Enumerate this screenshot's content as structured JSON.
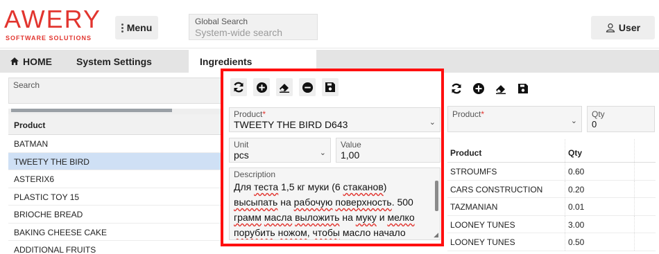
{
  "logo": {
    "main": "AWERY",
    "sub": "SOFTWARE SOLUTIONS"
  },
  "header": {
    "menu_label": "Menu",
    "search_label": "Global Search",
    "search_placeholder": "System-wide search",
    "user_label": "User"
  },
  "nav": {
    "home": "HOME",
    "settings": "System Settings",
    "ingredients": "Ingredients"
  },
  "left": {
    "search_label": "Search",
    "column_header": "Product",
    "items": [
      "BATMAN",
      "TWEETY THE BIRD",
      "ASTERIX6",
      "PLASTIC TOY 15",
      "BRIOCHE BREAD",
      "BAKING CHEESE CAKE",
      "ADDITIONAL FRUITS"
    ],
    "selected_index": 1
  },
  "form": {
    "product_label": "Product",
    "required_mark": "*",
    "product_value": "TWEETY THE BIRD D643",
    "unit_label": "Unit",
    "unit_value": "pcs",
    "value_label": "Value",
    "value_value": "1,00",
    "description_label": "Description",
    "description_segments": [
      {
        "t": "Для ",
        "u": false
      },
      {
        "t": "теста",
        "u": true
      },
      {
        "t": " 1,5 кг муки (6 ",
        "u": false
      },
      {
        "t": "стаканов",
        "u": true
      },
      {
        "t": ") ",
        "u": false
      },
      {
        "t": "высыпать",
        "u": true
      },
      {
        "t": " на ",
        "u": false
      },
      {
        "t": "рабочую",
        "u": true
      },
      {
        "t": " ",
        "u": false
      },
      {
        "t": "поверхность",
        "u": true
      },
      {
        "t": ". 500 ",
        "u": false
      },
      {
        "t": "грамм",
        "u": true
      },
      {
        "t": " ",
        "u": false
      },
      {
        "t": "масла",
        "u": true
      },
      {
        "t": " ",
        "u": false
      },
      {
        "t": "выложить",
        "u": true
      },
      {
        "t": " на ",
        "u": false
      },
      {
        "t": "муку",
        "u": true
      },
      {
        "t": " и ",
        "u": false
      },
      {
        "t": "мелко",
        "u": true
      },
      {
        "t": " ",
        "u": false
      },
      {
        "t": "порубить",
        "u": true
      },
      {
        "t": " ",
        "u": false
      },
      {
        "t": "ножом",
        "u": true
      },
      {
        "t": ", ",
        "u": false
      },
      {
        "t": "чтобы",
        "u": true
      },
      {
        "t": " масло начало",
        "u": false
      }
    ]
  },
  "right": {
    "product_label": "Product",
    "required_mark": "*",
    "qty_label": "Qty",
    "qty_value": "0",
    "col_product": "Product",
    "col_qty": "Qty",
    "rows": [
      {
        "product": "STROUMFS",
        "qty": "0.60"
      },
      {
        "product": "CARS CONSTRUCTION",
        "qty": "0.20"
      },
      {
        "product": "TAZMANIAN",
        "qty": "0.01"
      },
      {
        "product": "LOONEY TUNES",
        "qty": "3.00"
      },
      {
        "product": "LOONEY TUNES",
        "qty": "0.50"
      }
    ]
  },
  "colors": {
    "brand": "#e2352f",
    "highlight": "#ff0f0f",
    "selected_row": "#cfe0f5"
  }
}
